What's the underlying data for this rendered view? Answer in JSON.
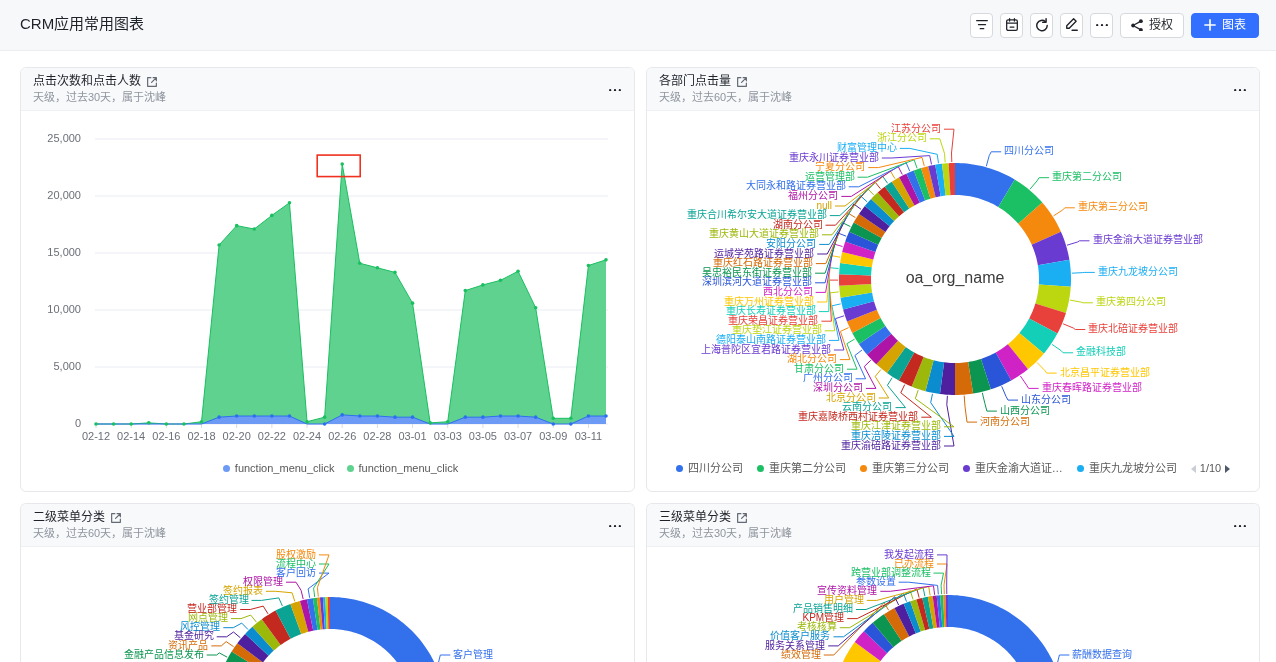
{
  "page": {
    "title": "CRM应用常用图表"
  },
  "toolbar": [
    {
      "kind": "default",
      "label": "授权"
    },
    {
      "kind": "primary",
      "label": "图表"
    }
  ],
  "cards": [
    {
      "kind": "area",
      "title": "点击次数和点击人数",
      "subtitle": "天级，过去30天，属于沈峰",
      "chart_data": {
        "type": "area",
        "stacked": false,
        "grid": true,
        "categories": [
          "02-12",
          null,
          "02-14",
          null,
          "02-16",
          null,
          "02-18",
          null,
          "02-20",
          null,
          "02-22",
          null,
          "02-24",
          null,
          "02-26",
          null,
          "02-28",
          null,
          "03-01",
          null,
          "03-03",
          null,
          "03-05",
          null,
          "03-07",
          null,
          "03-09",
          null,
          "03-11",
          null
        ],
        "ylim": [
          0,
          25000
        ],
        "yticks": [
          {
            "value": 0,
            "label": "0"
          },
          {
            "value": 5000,
            "label": "5,000"
          },
          {
            "value": 10000,
            "label": "10,000"
          },
          {
            "value": 15000,
            "label": "15,000"
          },
          {
            "value": 20000,
            "label": "20,000"
          },
          {
            "value": 25000,
            "label": "25,000"
          }
        ],
        "series": [
          {
            "name": "function_menu_click",
            "color": "#6d9af4",
            "values": [
              0,
              0,
              0,
              0,
              0,
              0,
              0,
              600,
              700,
              700,
              700,
              700,
              0,
              0,
              800,
              700,
              700,
              600,
              600,
              0,
              0,
              600,
              600,
              700,
              700,
              600,
              0,
              0,
              700,
              700
            ]
          },
          {
            "name": "function_menu_click",
            "color": "#5fd290",
            "values": [
              0,
              0,
              0,
              100,
              0,
              0,
              200,
              15700,
              17400,
              17100,
              18300,
              19400,
              200,
              600,
              22800,
              14100,
              13700,
              13300,
              10600,
              100,
              200,
              11700,
              12200,
              12600,
              13400,
              10200,
              500,
              500,
              13900,
              14400
            ]
          }
        ],
        "annotations": [
          {
            "x": "02-26"
          }
        ]
      }
    },
    {
      "kind": "donut",
      "title": "各部门点击量",
      "subtitle": "天级，过去60天，属于沈峰",
      "center_label": "oa_org_name",
      "right_side_slices": [
        {
          "label": "四川分公司",
          "color": "#3370eb"
        },
        {
          "label": "重庆第二分公司",
          "color": "#1bbf64"
        },
        {
          "label": "重庆第三分公司",
          "color": "#f5890d"
        },
        {
          "label": "重庆金渝大道证券营业部",
          "color": "#6a3bd0"
        },
        {
          "label": "重庆九龙坡分公司",
          "color": "#1aaef2"
        },
        {
          "label": "重庆第四分公司",
          "color": "#bcd60f"
        },
        {
          "label": "重庆北碚证券营业部",
          "color": "#e8403a"
        },
        {
          "label": "金融科技部",
          "color": "#13cfb8"
        },
        {
          "label": "北京昌平证券营业部",
          "color": "#fec700"
        },
        {
          "label": "重庆春晖路证券营业部",
          "color": "#d023c5"
        },
        {
          "label": "山东分公司",
          "color": "#2a55d8"
        },
        {
          "label": "山西分公司",
          "color": "#0b9550"
        },
        {
          "label": "河南分公司",
          "color": "#d46b08"
        }
      ],
      "left_side_slices": [
        {
          "label": "江苏分公司",
          "color": "#e8403a"
        },
        {
          "label": "浙江分公司",
          "color": "#bcd60f"
        },
        {
          "label": "财富管理中心",
          "color": "#1aaef2"
        },
        {
          "label": "重庆永川证券营业部",
          "color": "#6a3bd0"
        },
        {
          "label": "宁夏分公司",
          "color": "#f5890d"
        },
        {
          "label": "运营管理部",
          "color": "#1bbf64"
        },
        {
          "label": "大同永和路证券营业部",
          "color": "#3370eb"
        },
        {
          "label": "福州分公司",
          "color": "#ae14a6"
        },
        {
          "label": "null",
          "color": "#d6a400"
        },
        {
          "label": "重庆合川希尔安大道证券营业部",
          "color": "#0aa394"
        },
        {
          "label": "湖南分公司",
          "color": "#c4291f"
        },
        {
          "label": "重庆黄山大道证券营业部",
          "color": "#9cb80b"
        },
        {
          "label": "安阳分公司",
          "color": "#0b8ccf"
        },
        {
          "label": "运城学苑路证券营业部",
          "color": "#4e1f9e"
        },
        {
          "label": "重庆红石路证券营业部",
          "color": "#d46b08"
        },
        {
          "label": "吴忠裕民东街证券营业部",
          "color": "#0b9550"
        },
        {
          "label": "深圳滨河大道证券营业部",
          "color": "#2a55d8"
        },
        {
          "label": "西北分公司",
          "color": "#d023c5"
        },
        {
          "label": "重庆万州证券营业部",
          "color": "#fec700"
        },
        {
          "label": "重庆长寿证券营业部",
          "color": "#13cfb8"
        },
        {
          "label": "重庆荣昌证券营业部",
          "color": "#e8403a"
        },
        {
          "label": "重庆垫江证券营业部",
          "color": "#bcd60f"
        },
        {
          "label": "德阳泰山南路证券营业部",
          "color": "#1aaef2"
        },
        {
          "label": "上海普陀区宜君路证券营业部",
          "color": "#6a3bd0"
        },
        {
          "label": "湖北分公司",
          "color": "#f5890d"
        },
        {
          "label": "甘肃分公司",
          "color": "#1bbf64"
        },
        {
          "label": "广州分公司",
          "color": "#3370eb"
        },
        {
          "label": "深圳分公司",
          "color": "#ae14a6"
        },
        {
          "label": "北京分公司",
          "color": "#d6a400"
        },
        {
          "label": "云南分公司",
          "color": "#0aa394"
        },
        {
          "label": "重庆嘉陵桥西村证券营业部",
          "color": "#c4291f"
        },
        {
          "label": "重庆江津证券营业部",
          "color": "#9cb80b"
        },
        {
          "label": "重庆涪陵证券营业部",
          "color": "#0b8ccf"
        },
        {
          "label": "重庆渝碚路证券营业部",
          "color": "#4e1f9e"
        }
      ],
      "legend": {
        "items": [
          {
            "label": "四川分公司",
            "color": "#3370eb"
          },
          {
            "label": "重庆第二分公司",
            "color": "#1bbf64"
          },
          {
            "label": "重庆第三分公司",
            "color": "#f5890d"
          },
          {
            "label": "重庆金渝大道证…",
            "color": "#6a3bd0"
          },
          {
            "label": "重庆九龙坡分公司",
            "color": "#1aaef2"
          }
        ],
        "page": "1/10",
        "prev_disabled": true,
        "next_disabled": false
      }
    },
    {
      "kind": "donut",
      "title": "二级菜单分类",
      "subtitle": "天级，过去60天，属于沈峰",
      "right_side_slices": [
        {
          "label": "客户管理",
          "color": "#3370eb"
        }
      ],
      "left_side_slices": [
        {
          "label": "股权激励",
          "color": "#f5890d"
        },
        {
          "label": "流程中心",
          "color": "#1bbf64"
        },
        {
          "label": "客户回访",
          "color": "#3370eb"
        },
        {
          "label": "权限管理",
          "color": "#ae14a6"
        },
        {
          "label": "签约报表",
          "color": "#d6a400"
        },
        {
          "label": "签约管理",
          "color": "#0aa394"
        },
        {
          "label": "营业部管理",
          "color": "#c4291f"
        },
        {
          "label": "网点管理",
          "color": "#9cb80b"
        },
        {
          "label": "风控管理",
          "color": "#0b8ccf"
        },
        {
          "label": "基金研究",
          "color": "#4e1f9e"
        },
        {
          "label": "资讯产品",
          "color": "#d46b08"
        },
        {
          "label": "金融产品信息发布",
          "color": "#0b9550"
        }
      ]
    },
    {
      "kind": "donut",
      "title": "三级菜单分类",
      "subtitle": "天级，过去30天，属于沈峰",
      "right_side_slices": [
        {
          "label": "薪酬数据查询",
          "color": "#3370eb"
        }
      ],
      "left_side_slices": [
        {
          "label": "我发起流程",
          "color": "#6a3bd0"
        },
        {
          "label": "已办流程",
          "color": "#f5890d"
        },
        {
          "label": "跨营业部调整流程",
          "color": "#1bbf64"
        },
        {
          "label": "参数设置",
          "color": "#3370eb"
        },
        {
          "label": "宣传资料管理",
          "color": "#ae14a6"
        },
        {
          "label": "用户管理",
          "color": "#d6a400"
        },
        {
          "label": "产品销售明细",
          "color": "#0aa394"
        },
        {
          "label": "KPM管理",
          "color": "#c4291f"
        },
        {
          "label": "考核核算",
          "color": "#9cb80b"
        },
        {
          "label": "价值客户服务",
          "color": "#0b8ccf"
        },
        {
          "label": "服务关系管理",
          "color": "#4e1f9e"
        },
        {
          "label": "绩效管理",
          "color": "#d46b08"
        }
      ]
    }
  ]
}
